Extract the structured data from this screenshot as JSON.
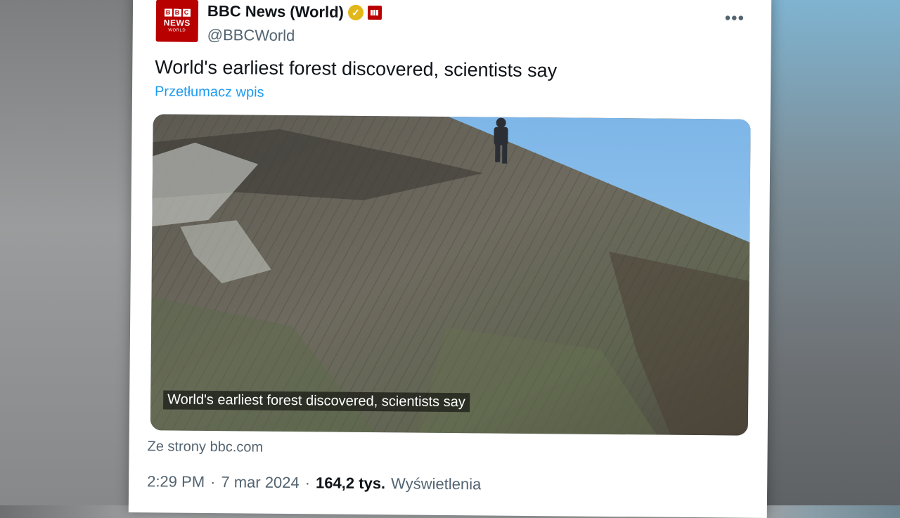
{
  "account": {
    "display_name": "BBC News (World)",
    "handle": "@BBCWorld",
    "avatar": {
      "letters": [
        "B",
        "B",
        "C"
      ],
      "news": "NEWS",
      "world": "WORLD"
    },
    "verified_icon": "verified-badge-icon",
    "affiliation_icon": "bbc-affiliation-icon"
  },
  "more_menu": "•••",
  "tweet": {
    "text": "World's earliest forest discovered, scientists say",
    "translate_label": "Przetłumacz wpis"
  },
  "media": {
    "caption": "World's earliest forest discovered, scientists say"
  },
  "card_source": "Ze strony bbc.com",
  "meta": {
    "time": "2:29 PM",
    "separator": "·",
    "date": "7 mar 2024",
    "views_count": "164,2 tys.",
    "views_label": "Wyświetlenia"
  },
  "colors": {
    "brand_red": "#b80000",
    "link_blue": "#1d9bf0",
    "verified_gold": "#e2b719"
  }
}
